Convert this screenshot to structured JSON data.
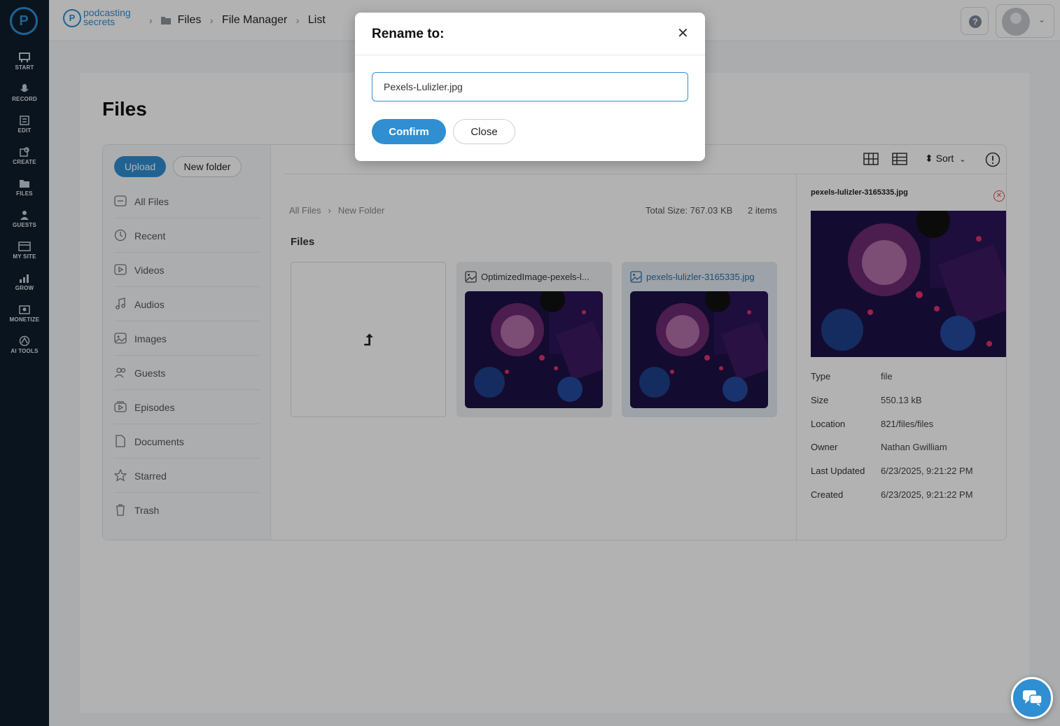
{
  "nav": {
    "items": [
      {
        "label": "START",
        "icon": "start-icon"
      },
      {
        "label": "RECORD",
        "icon": "mic-icon"
      },
      {
        "label": "EDIT",
        "icon": "edit-icon"
      },
      {
        "label": "CREATE",
        "icon": "create-icon"
      },
      {
        "label": "FILES",
        "icon": "files-icon"
      },
      {
        "label": "GUESTS",
        "icon": "guests-icon"
      },
      {
        "label": "MY SITE",
        "icon": "site-icon"
      },
      {
        "label": "GROW",
        "icon": "chart-icon"
      },
      {
        "label": "MONETIZE",
        "icon": "monetize-icon"
      },
      {
        "label": "AI TOOLS",
        "icon": "ai-icon"
      }
    ]
  },
  "brand": {
    "line1": "podcasting",
    "line2": "secrets"
  },
  "breadcrumb": [
    "Files",
    "File Manager",
    "List"
  ],
  "page": {
    "title": "Files"
  },
  "sidebar": {
    "upload_label": "Upload",
    "new_folder_label": "New folder",
    "items": [
      {
        "label": "All Files"
      },
      {
        "label": "Recent"
      },
      {
        "label": "Videos"
      },
      {
        "label": "Audios"
      },
      {
        "label": "Images"
      },
      {
        "label": "Guests"
      },
      {
        "label": "Episodes"
      },
      {
        "label": "Documents"
      },
      {
        "label": "Starred"
      },
      {
        "label": "Trash"
      }
    ]
  },
  "toolbar": {
    "sort_label": "Sort"
  },
  "path": {
    "root": "All Files",
    "folder": "New Folder"
  },
  "summary": {
    "total_size": "Total Size: 767.03 KB",
    "count": "2 items"
  },
  "files_heading": "Files",
  "files": [
    {
      "name": "OptimizedImage-pexels-l..."
    },
    {
      "name": "pexels-lulizler-3165335.jpg"
    }
  ],
  "detail": {
    "name": "pexels-lulizler-3165335.jpg",
    "rows": [
      {
        "k": "Type",
        "v": "file"
      },
      {
        "k": "Size",
        "v": "550.13 kB"
      },
      {
        "k": "Location",
        "v": "821/files/files"
      },
      {
        "k": "Owner",
        "v": "Nathan Gwilliam"
      },
      {
        "k": "Last Updated",
        "v": "6/23/2025, 9:21:22 PM"
      },
      {
        "k": "Created",
        "v": "6/23/2025, 9:21:22 PM"
      }
    ]
  },
  "modal": {
    "title": "Rename to:",
    "input_value": "Pexels-Lulizler.jpg",
    "confirm_label": "Confirm",
    "close_label": "Close"
  },
  "colors": {
    "accent": "#2f8fd2",
    "nav_bg": "#0f1d2b"
  }
}
